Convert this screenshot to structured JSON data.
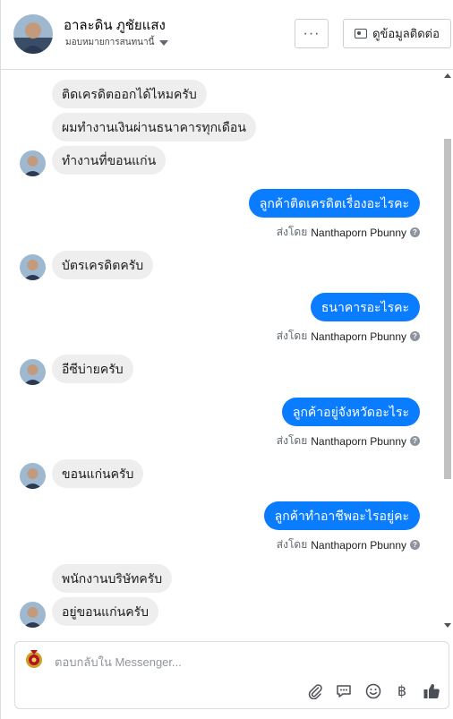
{
  "header": {
    "contact_name": "อาละดิน ภูชัยแสง",
    "assign_label": "มอบหมายการสนทนานี้",
    "more_label": "···",
    "view_contact_label": "ดูข้อมูลติดต่อ"
  },
  "messages": [
    {
      "dir": "in",
      "text": "ติดเครดิตออกได้ไหมครับ"
    },
    {
      "dir": "in",
      "text": "ผมทำงานเงินผ่านธนาคารทุกเดือน"
    },
    {
      "dir": "in",
      "text": "ทำงานที่ขอนแก่น"
    },
    {
      "dir": "out",
      "text": "ลูกค้าติดเครดิตเรื่องอะไรคะ",
      "sent_by_prefix": "ส่งโดย",
      "sent_by_name": "Nanthaporn Pbunny"
    },
    {
      "dir": "in",
      "text": "บัตรเครดิตครับ"
    },
    {
      "dir": "out",
      "text": "ธนาคารอะไรคะ",
      "sent_by_prefix": "ส่งโดย",
      "sent_by_name": "Nanthaporn Pbunny"
    },
    {
      "dir": "in",
      "text": "อีซีบ่ายครับ"
    },
    {
      "dir": "out",
      "text": "ลูกค้าอยู่จังหวัดอะไระ",
      "sent_by_prefix": "ส่งโดย",
      "sent_by_name": "Nanthaporn Pbunny"
    },
    {
      "dir": "in",
      "text": "ขอนแก่นครับ"
    },
    {
      "dir": "out",
      "text": "ลูกค้าทำอาชีพอะไรอยู่คะ",
      "sent_by_prefix": "ส่งโดย",
      "sent_by_name": "Nanthaporn Pbunny"
    },
    {
      "dir": "in",
      "text": "พนักงานบริษัทครับ"
    },
    {
      "dir": "in",
      "text": "อยู่ขอนแก่นครับ"
    }
  ],
  "composer": {
    "placeholder": "ตอบกลับใน Messenger..."
  },
  "toolbar": {
    "icons": [
      "paperclip-icon",
      "quick-reply-icon",
      "emoji-icon",
      "baht-payment-icon",
      "like-icon"
    ],
    "baht_glyph": "฿"
  },
  "colors": {
    "outgoing_bubble": "#0a7cff",
    "incoming_bubble": "#eeeeee",
    "border": "#dadde1",
    "meta_text": "#606770"
  }
}
